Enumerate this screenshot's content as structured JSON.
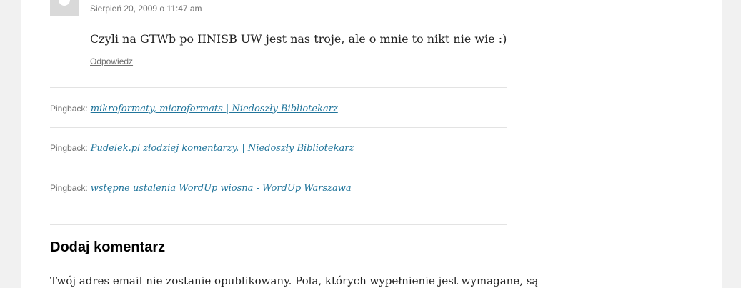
{
  "comment": {
    "date": "Sierpień 20, 2009 o 11:47 am",
    "text": "Czyli na GTWb po IINISB UW jest nas troje, ale o mnie to nikt nie wie :)",
    "reply_label": "Odpowiedz"
  },
  "pingbacks": [
    {
      "label": "Pingback:",
      "title": "mikroformaty, microformats | Niedoszły Bibliotekarz"
    },
    {
      "label": "Pingback:",
      "title": "Pudelek.pl złodziej komentarzy. | Niedoszły Bibliotekarz"
    },
    {
      "label": "Pingback:",
      "title": "wstępne ustalenia WordUp wiosna - WordUp Warszawa"
    }
  ],
  "respond": {
    "title": "Dodaj komentarz",
    "notes": "Twój adres email nie zostanie opublikowany. Pola, których wypełnienie jest wymagane, są"
  },
  "colors": {
    "link": "#21759b",
    "meta": "#707070",
    "background": "#f1f1f1"
  }
}
